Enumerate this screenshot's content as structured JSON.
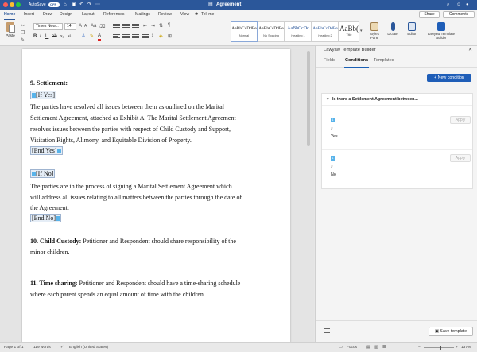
{
  "titlebar": {
    "autosave_label": "AutoSave",
    "autosave_state": "OFF",
    "doc_title": "Agreement",
    "title_icon": "word-doc-icon",
    "search_icon": "search-icon",
    "smiley_icon": "smiley-icon",
    "account_icon": "account-icon"
  },
  "ribbon_tabs": [
    "Home",
    "Insert",
    "Draw",
    "Design",
    "Layout",
    "References",
    "Mailings",
    "Review",
    "View",
    "Tell me"
  ],
  "share_label": "Share",
  "comments_label": "Comments",
  "ribbon": {
    "paste_label": "Paste",
    "font_name": "Times New...",
    "font_size": "14",
    "styles": [
      {
        "sample": "AaBbCcDdEe",
        "name": "Normal"
      },
      {
        "sample": "AaBbCcDdEe",
        "name": "No Spacing"
      },
      {
        "sample": "AaBbCcDc",
        "name": "Heading 1"
      },
      {
        "sample": "AaBbCcDdEe",
        "name": "Heading 2"
      },
      {
        "sample": "AaBb(",
        "name": "Title"
      }
    ],
    "styles_pane_label": "Styles Pane",
    "dictate_label": "Dictate",
    "editor_label": "Editor",
    "lawyaw_label": "Lawyaw Template Builder"
  },
  "document": {
    "section9_heading": "9. Settlement:",
    "if_yes": "[If Yes]",
    "yes_line1": "The parties have resolved all issues between them as outlined on the Marital",
    "yes_line2": "Settlement Agreement, attached as Exhibit A. The Marital Settlement Agreement",
    "yes_line3": "resolves issues between the parties with respect of Child Custody and Support,",
    "yes_line4": "Visitation Rights, Alimony, and Equitable Division of Property.",
    "end_yes": "[End Yes]",
    "if_no": "[If No]",
    "no_line1": "The parties are in the process of signing a Marital Settlement Agreement which",
    "no_line2": "will address all issues relating to all matters between the parties through the date of",
    "no_line3": "the Agreement.",
    "end_no": "[End No]",
    "section10_heading": "10. Child Custody:",
    "section10_text1": "Petitioner and Respondent should share responsibility of the",
    "section10_text2": "minor children.",
    "section11_heading": "11. Time sharing:",
    "section11_text1": "Petitioner and Respondent should have a time-sharing schedule",
    "section11_text2": "where each parent spends an equal amount of time with the children."
  },
  "panel": {
    "title": "Lawyaw Template Builder",
    "close_icon": "close-icon",
    "tabs": [
      "Fields",
      "Conditions",
      "Templates"
    ],
    "active_tab": "Conditions",
    "new_condition_label": "+ New condition",
    "condition_title": "Is there a Settlement Agreement between...",
    "options": [
      {
        "number": "1",
        "if_label": "if",
        "value": "Yes",
        "apply_label": "Apply"
      },
      {
        "number": "1",
        "if_label": "if",
        "value": "No",
        "apply_label": "Apply"
      }
    ],
    "save_template_label": "Save template"
  },
  "statusbar": {
    "page": "Page 1 of 1",
    "words": "119 words",
    "language": "English (United States)",
    "focus_label": "Focus",
    "zoom": "137%"
  },
  "colors": {
    "word_blue": "#2b579a",
    "field_handle": "#58b3ea",
    "primary_button": "#1f5eb8"
  }
}
